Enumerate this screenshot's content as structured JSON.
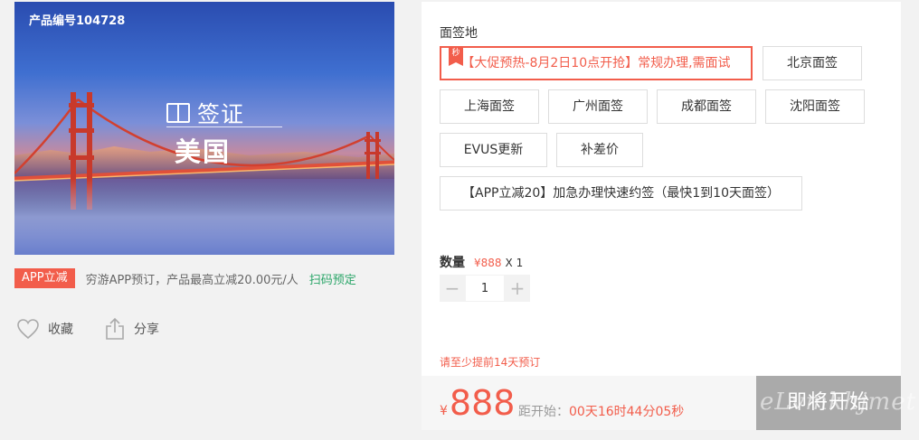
{
  "product": {
    "code_label": "产品编号104728",
    "visa_label": "签证",
    "country": "美国"
  },
  "promo": {
    "badge": "APP立减",
    "description": "穷游APP预订，产品最高立减20.00元/人",
    "scan_link": "扫码预定"
  },
  "actions": {
    "favorite": "收藏",
    "share": "分享"
  },
  "booking": {
    "section_title": "面签地",
    "seckill_flag": "秒",
    "options": [
      "【大促预热-8月2日10点开抢】常规办理,需面试",
      "北京面签",
      "上海面签",
      "广州面签",
      "成都面签",
      "沈阳面签",
      "EVUS更新",
      "补差价",
      "【APP立减20】加急办理快速约签（最快1到10天面签）"
    ],
    "selected_index": 0,
    "quantity_label": "数量",
    "unit_price": "¥888",
    "multiplier": "X 1",
    "quantity_value": "1",
    "minus": "−",
    "plus": "+",
    "notice": "请至少提前14天预订",
    "currency": "¥",
    "price": "888",
    "countdown_label": "距开始：",
    "countdown_time": "00天16时44分05秒",
    "start_button": "即将开始"
  },
  "watermark": "eLvmkhjmet",
  "colors": {
    "accent": "#f25d4b",
    "scan_link": "#2aa568",
    "disabled_button": "#aaaaaa",
    "panel_bg": "#ffffff",
    "page_bg": "#f2f2f2"
  },
  "icons": {
    "favorite": "heart-icon",
    "share": "share-icon",
    "visa": "passport-icon"
  }
}
